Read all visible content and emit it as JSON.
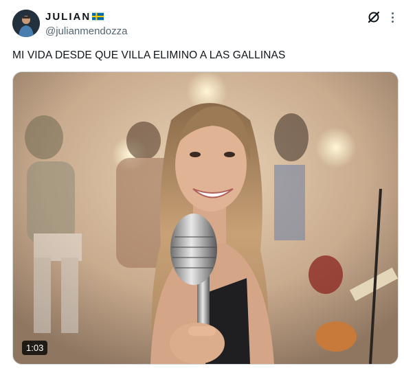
{
  "post": {
    "author": {
      "display_name": "JULIAN",
      "flag_icon": "sweden-flag-icon",
      "handle": "@julianmendozza"
    },
    "text": "MI VIDA DESDE QUE VILLA ELIMINO A LAS GALLINAS",
    "media": {
      "type": "video",
      "duration": "1:03"
    }
  },
  "icons": {
    "grok": "grok-icon",
    "more": "more-options-icon"
  },
  "colors": {
    "text_primary": "#0f1419",
    "text_secondary": "#536471",
    "border": "#cfd9de",
    "flag_blue": "#006aa7",
    "flag_yellow": "#fecc00"
  }
}
